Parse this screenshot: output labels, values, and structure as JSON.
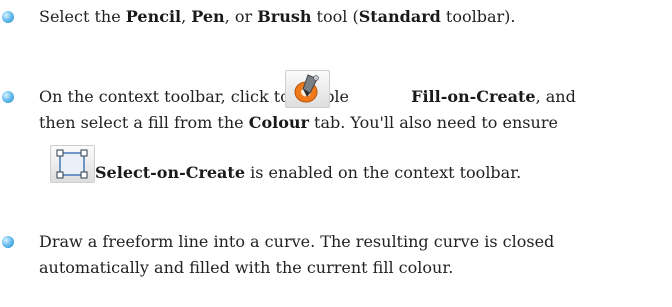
{
  "steps": [
    {
      "lines": [
        {
          "segments": [
            {
              "text": "Select the ",
              "bold": false
            },
            {
              "text": "Pencil",
              "bold": true
            },
            {
              "text": ", ",
              "bold": false
            },
            {
              "text": "Pen",
              "bold": true
            },
            {
              "text": ", or ",
              "bold": false
            },
            {
              "text": "Brush",
              "bold": true
            },
            {
              "text": " tool (",
              "bold": false
            },
            {
              "text": "Standard",
              "bold": true
            },
            {
              "text": " toolbar).",
              "bold": false
            }
          ]
        }
      ]
    },
    {
      "lines": [
        {
          "segments": [
            {
              "text": "On the context toolbar, click to enable ",
              "bold": false
            },
            {
              "text": "Fill-on-Create",
              "bold": true
            },
            {
              "text": ", and",
              "bold": false
            }
          ]
        },
        {
          "segments": [
            {
              "text": "then select a fill from the ",
              "bold": false
            },
            {
              "text": "Colour",
              "bold": true
            },
            {
              "text": " tab. You'll also need to ensure",
              "bold": false
            }
          ]
        },
        {
          "segments": [
            {
              "text": "Select-on-Create",
              "bold": true
            },
            {
              "text": " is enabled on the context toolbar.",
              "bold": false
            }
          ]
        }
      ]
    },
    {
      "lines": [
        {
          "segments": [
            {
              "text": "Draw a freeform line into a curve. The resulting curve is closed",
              "bold": false
            }
          ]
        },
        {
          "segments": [
            {
              "text": "automatically and filled with the current fill colour.",
              "bold": false
            }
          ]
        }
      ]
    }
  ],
  "icons": {
    "fill_on_create": "fill-on-create-icon",
    "select_on_create": "select-on-create-icon"
  },
  "colors": {
    "text": "#222222",
    "bullet": "#4aa8e0",
    "fill_icon_orange": "#f07a1a",
    "select_icon_blue": "#3a6fb0"
  }
}
